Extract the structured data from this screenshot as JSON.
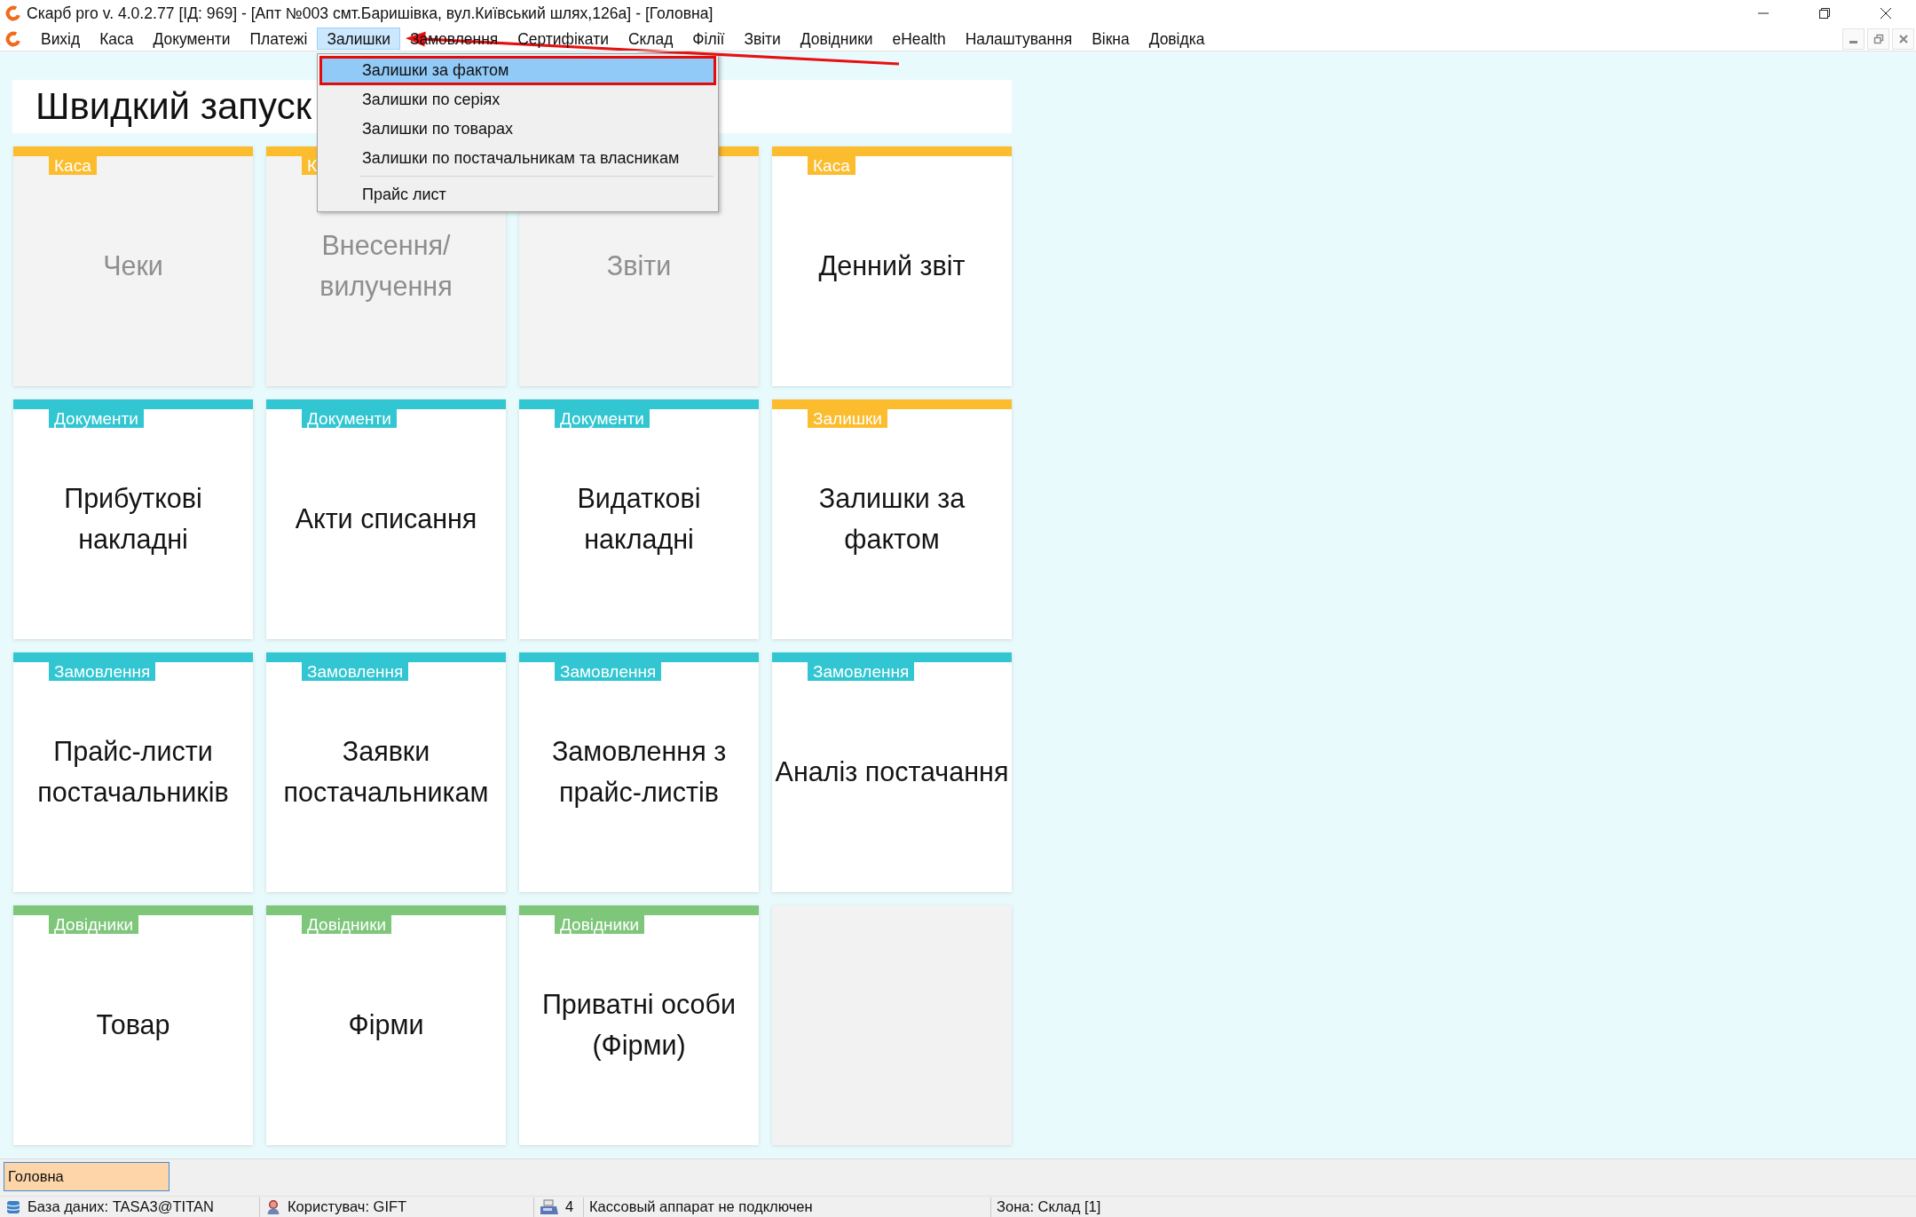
{
  "window": {
    "title": "Скарб pro v. 4.0.2.77 [ІД: 969] - [Апт №003 смт.Баришівка, вул.Київський шлях,126а] - [Головна]"
  },
  "menu_bar": {
    "items": [
      {
        "label": "Вихід",
        "selected": false
      },
      {
        "label": "Каса",
        "selected": false
      },
      {
        "label": "Документи",
        "selected": false
      },
      {
        "label": "Платежі",
        "selected": false
      },
      {
        "label": "Залишки",
        "selected": true
      },
      {
        "label": "Замовлення",
        "selected": false
      },
      {
        "label": "Сертифікати",
        "selected": false
      },
      {
        "label": "Склад",
        "selected": false
      },
      {
        "label": "Філії",
        "selected": false
      },
      {
        "label": "Звіти",
        "selected": false
      },
      {
        "label": "Довідники",
        "selected": false
      },
      {
        "label": "eHealth",
        "selected": false
      },
      {
        "label": "Налаштування",
        "selected": false
      },
      {
        "label": "Вікна",
        "selected": false
      },
      {
        "label": "Довідка",
        "selected": false
      }
    ]
  },
  "dropdown": {
    "items": [
      {
        "kind": "item",
        "label": "Залишки за фактом",
        "selected": true
      },
      {
        "kind": "item",
        "label": "Залишки по серіях",
        "selected": false
      },
      {
        "kind": "item",
        "label": "Залишки по товарах",
        "selected": false
      },
      {
        "kind": "item",
        "label": "Залишки по постачальникам та власникам",
        "selected": false
      },
      {
        "kind": "separator"
      },
      {
        "kind": "item",
        "label": "Прайс лист",
        "selected": false
      }
    ]
  },
  "quick_launch": {
    "title": "Швидкий запуск",
    "tiles": [
      {
        "kind": "shortcut",
        "tag": "Каса",
        "color": "#fbbc2e",
        "label": "Чеки",
        "disabled": true
      },
      {
        "kind": "shortcut",
        "tag": "К",
        "color": "#fbbc2e",
        "label": "Внесення/вилучення",
        "disabled": true
      },
      {
        "kind": "shortcut",
        "color": "#fbbc2e",
        "label": "Звіти",
        "disabled": true
      },
      {
        "kind": "shortcut",
        "tag": "Каса",
        "color": "#fbbc2e",
        "label": "Денний звіт",
        "disabled": false
      },
      {
        "kind": "shortcut",
        "tag": "Документи",
        "color": "#31c6d1",
        "label": "Прибуткові накладні",
        "disabled": false
      },
      {
        "kind": "shortcut",
        "tag": "Документи",
        "color": "#31c6d1",
        "label": "Акти списання",
        "disabled": false
      },
      {
        "kind": "shortcut",
        "tag": "Документи",
        "color": "#31c6d1",
        "label": "Видаткові накладні",
        "disabled": false
      },
      {
        "kind": "shortcut",
        "tag": "Залишки",
        "color": "#fbbc2e",
        "label": "Залишки за фактом",
        "disabled": false
      },
      {
        "kind": "shortcut",
        "tag": "Замовлення",
        "color": "#31c6d1",
        "label": "Прайс-листи постачальників",
        "disabled": false
      },
      {
        "kind": "shortcut",
        "tag": "Замовлення",
        "color": "#31c6d1",
        "label": "Заявки постачальникам",
        "disabled": false
      },
      {
        "kind": "shortcut",
        "tag": "Замовлення",
        "color": "#31c6d1",
        "label": "Замовлення з прайс-листів",
        "disabled": false
      },
      {
        "kind": "shortcut",
        "tag": "Замовлення",
        "color": "#31c6d1",
        "label": "Аналіз постачання",
        "disabled": false
      },
      {
        "kind": "shortcut",
        "tag": "Довідники",
        "color": "#7dc67a",
        "label": "Товар",
        "disabled": false
      },
      {
        "kind": "shortcut",
        "tag": "Довідники",
        "color": "#7dc67a",
        "label": "Фірми",
        "disabled": false
      },
      {
        "kind": "shortcut",
        "tag": "Довідники",
        "color": "#7dc67a",
        "label": "Приватні особи (Фірми)",
        "disabled": false
      },
      {
        "kind": "empty"
      }
    ]
  },
  "window_tabs": [
    {
      "label": "Головна",
      "selected": true
    }
  ],
  "status_bar": [
    {
      "kind": "database",
      "text": "База даних: TASA3@TITAN"
    },
    {
      "kind": "user",
      "text": "Користувач: GIFT"
    },
    {
      "kind": "device",
      "text": "4"
    },
    {
      "kind": "plain",
      "text": "Кассовый аппарат не подключен"
    },
    {
      "kind": "plain",
      "text": "Зона: Склад [1]"
    }
  ]
}
